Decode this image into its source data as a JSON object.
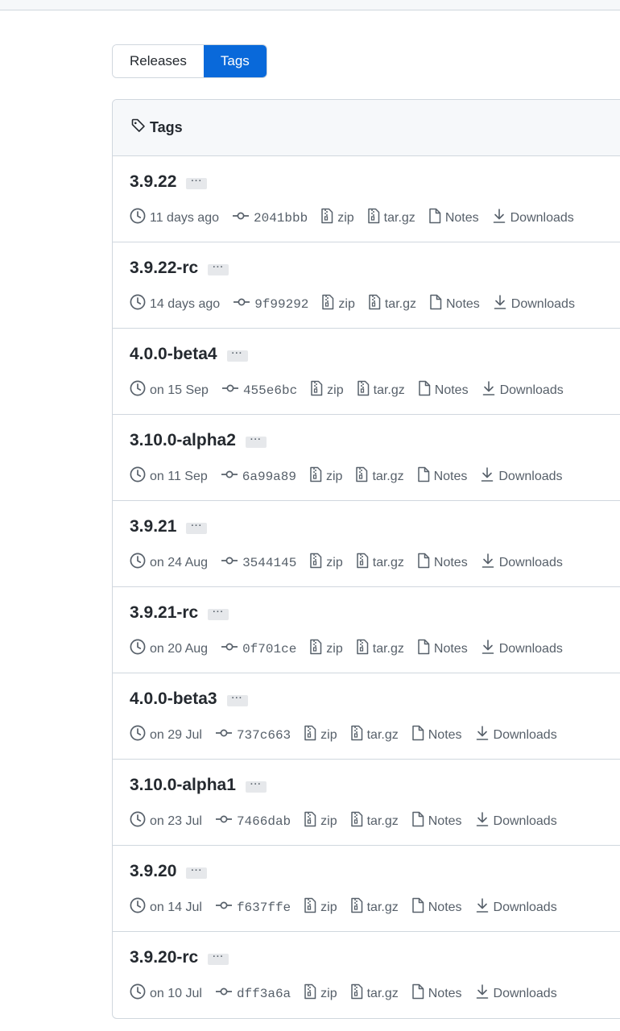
{
  "tabs": {
    "releases": "Releases",
    "tags": "Tags"
  },
  "box": {
    "title": "Tags"
  },
  "ellipsis": "···",
  "links": {
    "zip": "zip",
    "targz": "tar.gz",
    "notes": "Notes",
    "downloads": "Downloads"
  },
  "tags": [
    {
      "name": "3.9.22",
      "date": "11 days ago",
      "sha": "2041bbb"
    },
    {
      "name": "3.9.22-rc",
      "date": "14 days ago",
      "sha": "9f99292"
    },
    {
      "name": "4.0.0-beta4",
      "date": "on 15 Sep",
      "sha": "455e6bc"
    },
    {
      "name": "3.10.0-alpha2",
      "date": "on 11 Sep",
      "sha": "6a99a89"
    },
    {
      "name": "3.9.21",
      "date": "on 24 Aug",
      "sha": "3544145"
    },
    {
      "name": "3.9.21-rc",
      "date": "on 20 Aug",
      "sha": "0f701ce"
    },
    {
      "name": "4.0.0-beta3",
      "date": "on 29 Jul",
      "sha": "737c663"
    },
    {
      "name": "3.10.0-alpha1",
      "date": "on 23 Jul",
      "sha": "7466dab"
    },
    {
      "name": "3.9.20",
      "date": "on 14 Jul",
      "sha": "f637ffe"
    },
    {
      "name": "3.9.20-rc",
      "date": "on 10 Jul",
      "sha": "dff3a6a"
    }
  ]
}
